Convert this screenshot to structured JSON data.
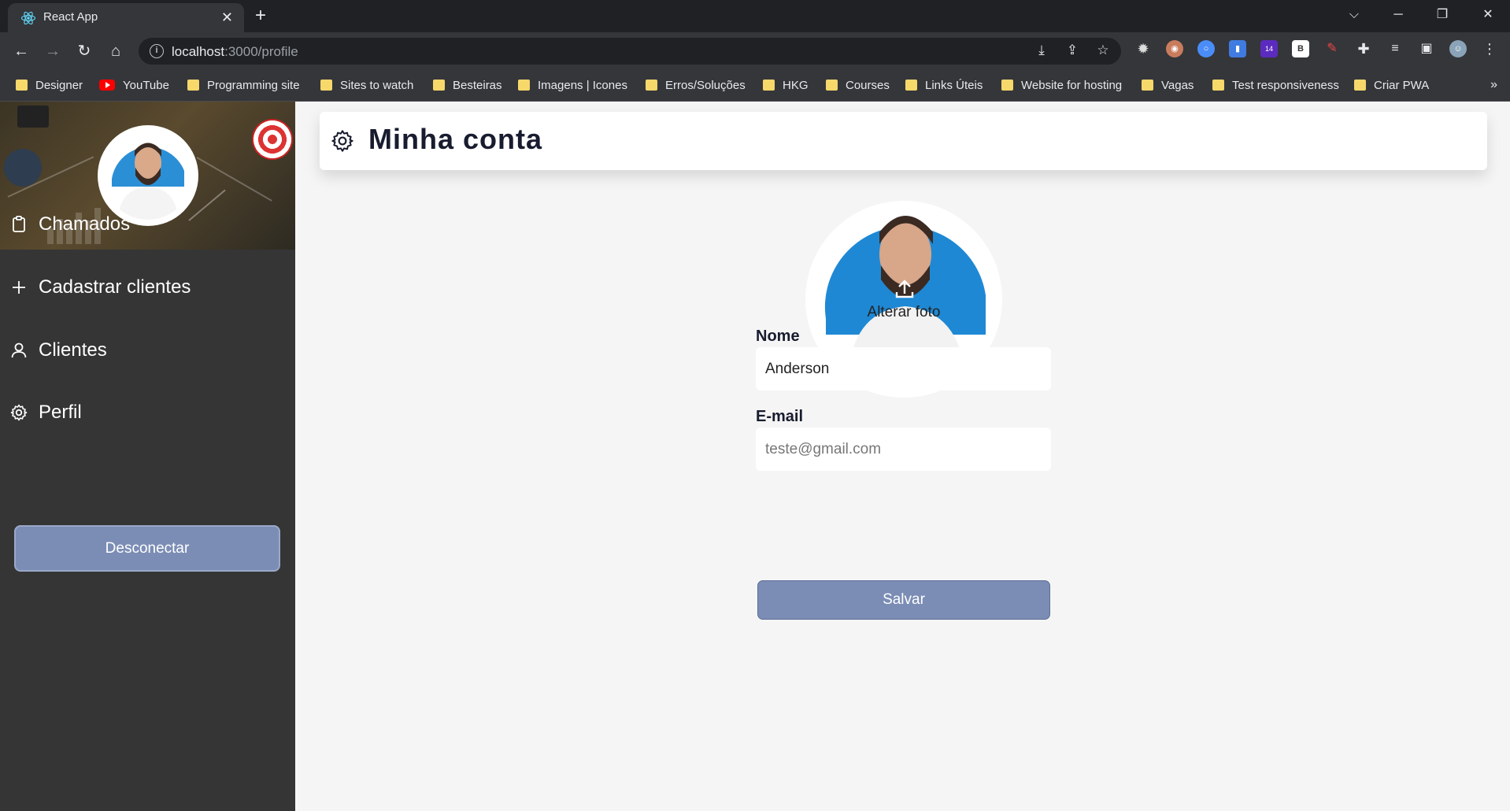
{
  "browser": {
    "tab_title": "React App",
    "url_host": "localhost",
    "url_rest": ":3000/profile",
    "bookmarks": [
      {
        "label": "Designer",
        "type": "folder"
      },
      {
        "label": "YouTube",
        "type": "youtube"
      },
      {
        "label": "Programming site",
        "type": "folder"
      },
      {
        "label": "Sites to watch",
        "type": "folder"
      },
      {
        "label": "Besteiras",
        "type": "folder"
      },
      {
        "label": "Imagens | Icones",
        "type": "folder"
      },
      {
        "label": "Erros/Soluções",
        "type": "folder"
      },
      {
        "label": "HKG",
        "type": "folder"
      },
      {
        "label": "Courses",
        "type": "folder"
      },
      {
        "label": "Links Úteis",
        "type": "folder"
      },
      {
        "label": "Website for hosting",
        "type": "folder"
      },
      {
        "label": "Vagas",
        "type": "folder"
      },
      {
        "label": "Test responsiveness",
        "type": "folder"
      },
      {
        "label": "Criar PWA",
        "type": "folder"
      }
    ],
    "extension_badge": "14",
    "more_bookmarks": "»"
  },
  "sidebar": {
    "items": [
      {
        "label": "Chamados",
        "icon": "clipboard-icon"
      },
      {
        "label": "Cadastrar clientes",
        "icon": "plus-icon"
      },
      {
        "label": "Clientes",
        "icon": "user-icon"
      },
      {
        "label": "Perfil",
        "icon": "gear-icon"
      }
    ],
    "logout_label": "Desconectar"
  },
  "main": {
    "title": "Minha conta",
    "photo_label": "Alterar foto",
    "name_label": "Nome",
    "name_value": "Anderson",
    "email_label": "E-mail",
    "email_placeholder": "teste@gmail.com",
    "save_label": "Salvar"
  },
  "colors": {
    "sidebar_bg": "#353535",
    "button_bg": "#7b8db5",
    "content_bg": "#f5f5f5"
  }
}
